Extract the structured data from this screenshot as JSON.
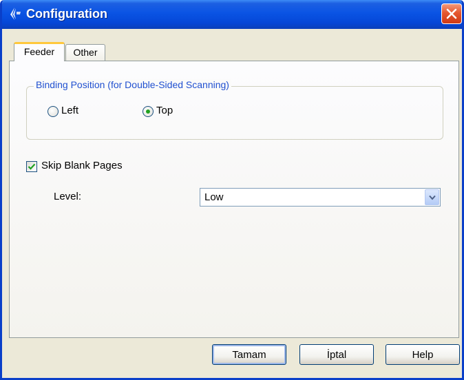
{
  "window": {
    "title": "Configuration",
    "icon": "scanner-app-icon"
  },
  "tabs": [
    {
      "label": "Feeder",
      "selected": true
    },
    {
      "label": "Other",
      "selected": false
    }
  ],
  "binding": {
    "group_label": "Binding Position (for Double-Sided Scanning)",
    "options": [
      {
        "label": "Left",
        "selected": false
      },
      {
        "label": "Top",
        "selected": true
      }
    ]
  },
  "skip_blank": {
    "label": "Skip Blank Pages",
    "checked": true
  },
  "level": {
    "label": "Level:",
    "value": "Low"
  },
  "buttons": {
    "ok": "Tamam",
    "cancel": "İptal",
    "help": "Help"
  },
  "colors": {
    "titlebar": "#0a54e4",
    "group_label": "#2050d0",
    "radio_dot": "#21a121",
    "close": "#e5572f"
  }
}
